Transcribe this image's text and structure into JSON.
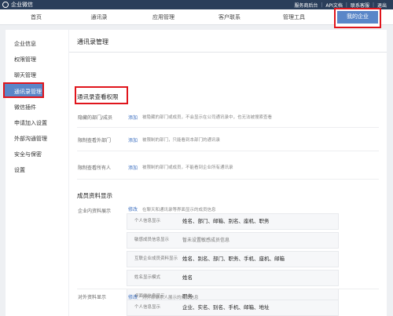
{
  "topbar": {
    "brand": "企业微信",
    "links": [
      "服务商后台",
      "API文档",
      "联系客服",
      "退出"
    ]
  },
  "nav": {
    "items": [
      "首页",
      "通讯录",
      "应用管理",
      "客户联系",
      "管理工具",
      "我的企业"
    ],
    "active": "我的企业"
  },
  "sidebar": {
    "items": [
      "企业信息",
      "权限管理",
      "聊天管理",
      "通讯录管理",
      "微信插件",
      "申请加入设置",
      "外部沟通管理",
      "安全与保密",
      "设置"
    ],
    "active": "通讯录管理"
  },
  "main": {
    "title": "通讯录管理",
    "perm_section": "通讯录查看权限",
    "perm_rows": [
      {
        "label": "隐藏的部门/成员",
        "action": "添加",
        "desc": "被隐藏的部门或成员，不会显示在公司通讯录中，也无法被搜索查看"
      },
      {
        "label": "限制查看外部门",
        "action": "添加",
        "desc": "被限制的部门，只能看到本部门的通讯录"
      },
      {
        "label": "限制查看所有人",
        "action": "添加",
        "desc": "被限制的部门或成员，不能看到企业所有通讯录"
      }
    ],
    "member_section": "成员资料显示",
    "internal": {
      "label": "企业内资料展示",
      "action": "修改",
      "desc": "在聊天和通讯录等界面显示的成员信息",
      "rows": [
        {
          "label": "个人信息显示",
          "value": "姓名、部门、邮箱、别名、座机、职务"
        },
        {
          "label": "敏感成员信息显示",
          "value": "暂未设置敏感成员信息"
        },
        {
          "label": "互联企业成员资料显示",
          "value": "姓名、别名、部门、职务、手机、座机、邮箱"
        },
        {
          "label": "姓名显示模式",
          "value": "姓名"
        },
        {
          "label": "桌面端信息显示",
          "value": "职务"
        }
      ]
    },
    "external": {
      "label": "对外资料显示",
      "action": "修改",
      "desc": "对外部联系人展示的成员信息",
      "rows": [
        {
          "label": "个人信息显示",
          "value": "企业、实名、别名、手机、邮箱、地址"
        }
      ]
    }
  }
}
